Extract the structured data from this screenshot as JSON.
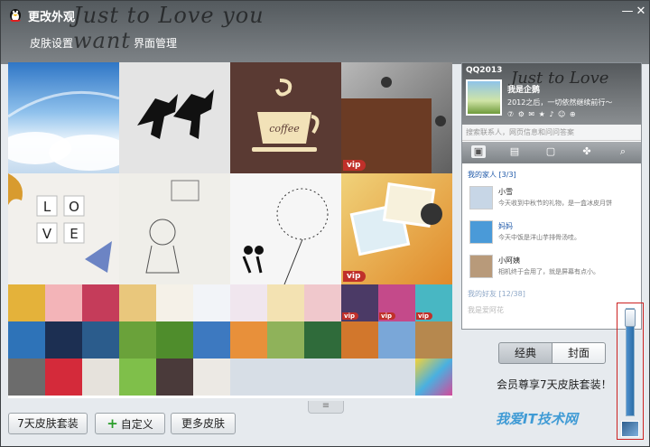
{
  "window": {
    "title": "更改外观",
    "deco_script": "Just to Love you want",
    "minimize_glyph": "—",
    "close_glyph": "✕"
  },
  "tabs": [
    {
      "label": "皮肤设置"
    },
    {
      "label": "界面管理"
    }
  ],
  "gallery": {
    "vip_badge": "vip",
    "big_tile_words": [
      "coffee",
      "L",
      "O",
      "V",
      "E"
    ]
  },
  "buttons": {
    "package": "7天皮肤套装",
    "custom": "自定义",
    "more": "更多皮肤",
    "handle_glyph": "≡"
  },
  "preview": {
    "app_title": "QQ2013",
    "script_text": "Just to Love",
    "nickname": "我是企鹅",
    "signature": "2012之后，一切依然继续前行～",
    "status_icons": "⑦ ⚙ ✉ ★ ♪ ☺ ⊕",
    "search_placeholder": "搜索联系人，网页信息和问问答案",
    "group_family": "我的家人 [3/3]",
    "group_friends": "我的好友 [12/38]",
    "contacts": [
      {
        "name": "小雪",
        "message": "今天收到中秋节的礼物，是一盒冰皮月饼"
      },
      {
        "name": "妈妈",
        "message": "今天中饭是洋山芋排骨汤哇。"
      },
      {
        "name": "小阿姨",
        "message": "相机终于会用了，就是屏幕有点小。"
      }
    ],
    "faded_contact": "我是爱阿花"
  },
  "mode_switch": {
    "classic": "经典",
    "cover": "封面",
    "selected": "经典"
  },
  "promo_text": "会员尊享7天皮肤套装！",
  "transparency_slider": {
    "level": 0.95
  },
  "watermark": "我爱IT技术网",
  "colors": {
    "vip_badge": "#c0302a",
    "group_label": "#1e58a8",
    "promo_border": "#cc2222"
  }
}
